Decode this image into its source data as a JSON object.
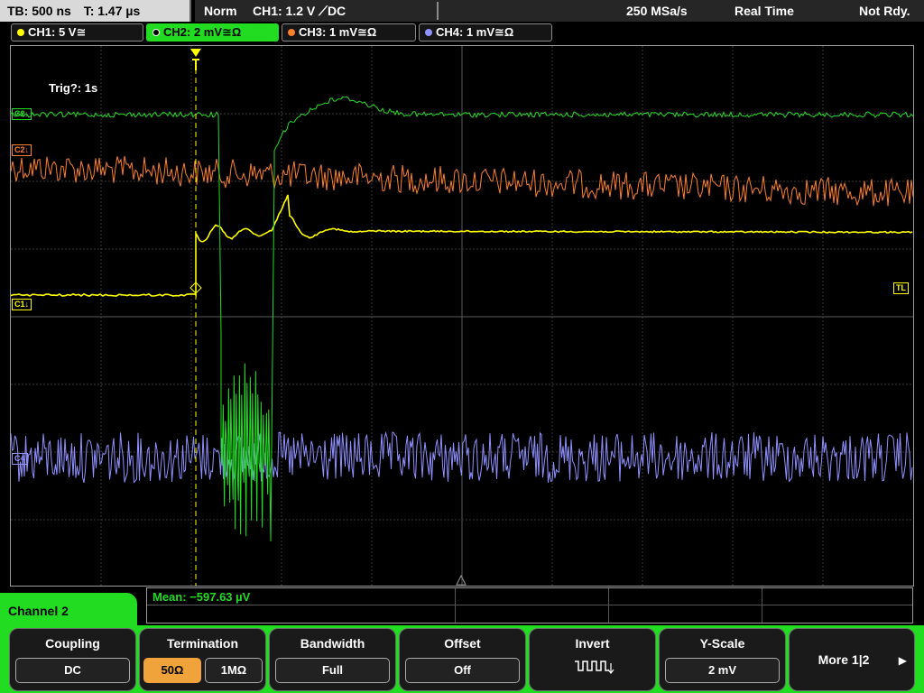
{
  "status": {
    "timebase": "TB: 500 ns",
    "trigger_time": "T: 1.47 µs",
    "mode": "Norm",
    "trigger": "CH1: 1.2 V ⟋DC",
    "sample_rate": "250 MSa/s",
    "acq": "Real Time",
    "state": "Not Rdy."
  },
  "channels": [
    {
      "label": "CH1: 5 V≅",
      "color": "#ffff00"
    },
    {
      "label": "CH2: 2 mV≅Ω",
      "color": "#22dc22"
    },
    {
      "label": "CH3: 1 mV≅Ω",
      "color": "#ff7f2a"
    },
    {
      "label": "CH4: 1 mV≅Ω",
      "color": "#9090ff"
    }
  ],
  "screen": {
    "trig_status": "Trig?: 1s",
    "markers": {
      "c1": "C1↓",
      "c2": "C2↓",
      "c4": "C4",
      "tl": "TL"
    }
  },
  "measurement": {
    "text": "Mean: −597.63 µV"
  },
  "channel_tab": "Channel 2",
  "menu": {
    "coupling": {
      "title": "Coupling",
      "value": "DC"
    },
    "termination": {
      "title": "Termination",
      "opt1": "50Ω",
      "opt2": "1MΩ"
    },
    "bandwidth": {
      "title": "Bandwidth",
      "value": "Full"
    },
    "offset": {
      "title": "Offset",
      "value": "Off"
    },
    "invert": {
      "title": "Invert"
    },
    "yscale": {
      "title": "Y-Scale",
      "value": "2 mV"
    },
    "more": {
      "label": "More 1|2"
    }
  }
}
